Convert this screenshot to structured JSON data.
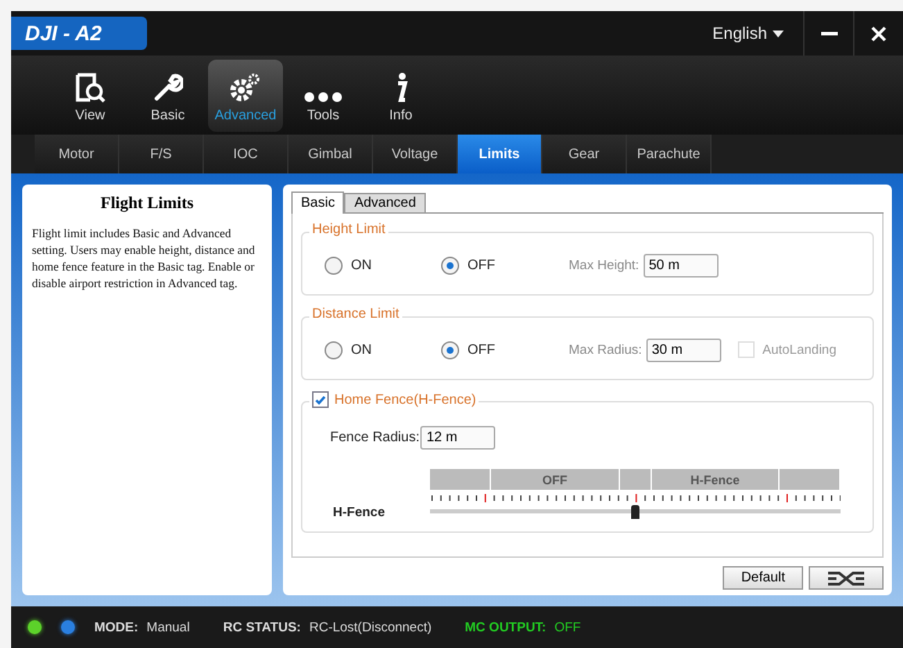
{
  "window": {
    "title": "DJI - A2",
    "language": "English"
  },
  "toolbar": [
    {
      "label": "View",
      "selected": false
    },
    {
      "label": "Basic",
      "selected": false
    },
    {
      "label": "Advanced",
      "selected": true
    },
    {
      "label": "Tools",
      "selected": false
    },
    {
      "label": "Info",
      "selected": false
    }
  ],
  "subtabs": [
    {
      "label": "Motor",
      "selected": false
    },
    {
      "label": "F/S",
      "selected": false
    },
    {
      "label": "IOC",
      "selected": false
    },
    {
      "label": "Gimbal",
      "selected": false
    },
    {
      "label": "Voltage",
      "selected": false
    },
    {
      "label": "Limits",
      "selected": true
    },
    {
      "label": "Gear",
      "selected": false
    },
    {
      "label": "Parachute",
      "selected": false
    }
  ],
  "help": {
    "title": "Flight Limits",
    "text": "Flight limit includes Basic and Advanced setting. Users may enable height, distance and home fence feature in the Basic tag. Enable or disable airport restriction in Advanced tag."
  },
  "tabs": [
    {
      "label": "Basic",
      "selected": true
    },
    {
      "label": "Advanced",
      "selected": false
    }
  ],
  "height_limit": {
    "title": "Height Limit",
    "options": [
      {
        "label": "ON",
        "selected": false
      },
      {
        "label": "OFF",
        "selected": true
      }
    ],
    "field_label": "Max Height:",
    "value": "50 m"
  },
  "distance_limit": {
    "title": "Distance Limit",
    "options": [
      {
        "label": "ON",
        "selected": false
      },
      {
        "label": "OFF",
        "selected": true
      }
    ],
    "field_label": "Max Radius:",
    "value": "30 m",
    "autolanding": {
      "label": "AutoLanding",
      "checked": false,
      "disabled": true
    }
  },
  "home_fence": {
    "title": "Home Fence(H-Fence)",
    "checked": true,
    "field_label": "Fence Radius:",
    "value": "12 m",
    "slider_label": "H-Fence",
    "segments": [
      "OFF",
      "H-Fence"
    ],
    "level": 0.5
  },
  "buttons": {
    "default": "Default"
  },
  "status": {
    "mode_label": "MODE:",
    "mode": "Manual",
    "rc_label": "RC STATUS:",
    "rc": "RC-Lost(Disconnect)",
    "mc_label": "MC OUTPUT:",
    "mc": "OFF"
  }
}
